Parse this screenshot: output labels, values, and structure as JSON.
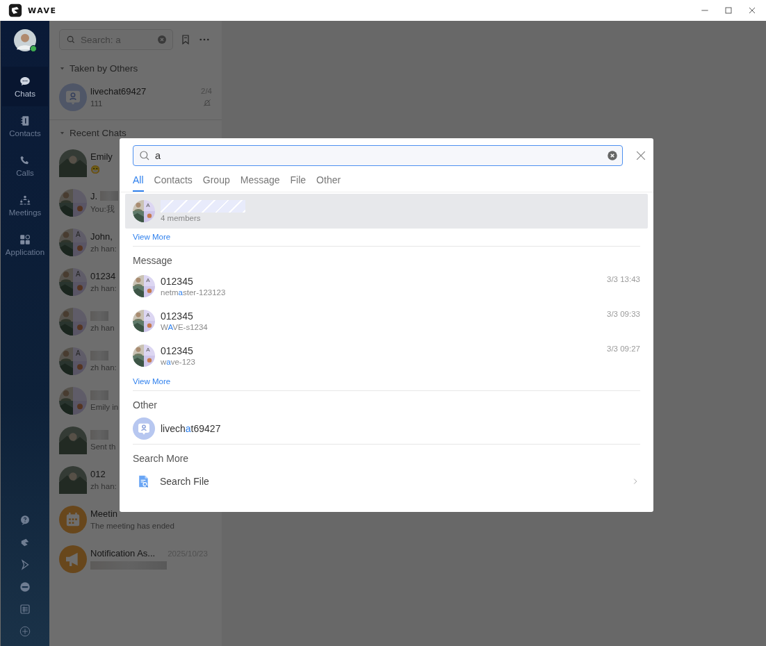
{
  "titlebar": {
    "app_name": "WAVE"
  },
  "nav": {
    "items": [
      {
        "label": "Chats",
        "selected": true
      },
      {
        "label": "Contacts",
        "selected": false
      },
      {
        "label": "Calls",
        "selected": false
      },
      {
        "label": "Meetings",
        "selected": false
      },
      {
        "label": "Application",
        "selected": false
      }
    ]
  },
  "chat_list": {
    "search": {
      "placeholder": "Search: a"
    },
    "sections": [
      {
        "title": "Taken by Others",
        "expanded": true,
        "items": [
          {
            "avatar": {
              "kind": "livechat"
            },
            "name": "livechat69427",
            "preview": "111",
            "count": "2/4",
            "muted": true
          }
        ]
      },
      {
        "title": "Recent Chats",
        "expanded": true,
        "items": [
          {
            "avatar": {
              "kind": "photo"
            },
            "name": "Emily",
            "preview": "😁",
            "redacted": false
          },
          {
            "avatar": {
              "kind": "group"
            },
            "name": "J.",
            "preview": "You:我",
            "redacted": true
          },
          {
            "avatar": {
              "kind": "group",
              "letter": "A"
            },
            "name": "John,",
            "preview": "zh han:",
            "redacted": false
          },
          {
            "avatar": {
              "kind": "group",
              "letter": "A"
            },
            "name": "01234",
            "preview": "zh han:",
            "redacted": false
          },
          {
            "avatar": {
              "kind": "group"
            },
            "preview": "zh han",
            "redacted": true
          },
          {
            "avatar": {
              "kind": "group",
              "letter": "A"
            },
            "preview": "zh han:",
            "redacted": true
          },
          {
            "avatar": {
              "kind": "group"
            },
            "preview": "Emily in",
            "redacted": true
          },
          {
            "avatar": {
              "kind": "photo"
            },
            "preview": "Sent th",
            "redacted": true
          },
          {
            "avatar": {
              "kind": "photo"
            },
            "name": "012",
            "preview": "zh han:",
            "redacted": false
          },
          {
            "avatar": {
              "kind": "meeting"
            },
            "name": "Meetin",
            "preview": "The meeting has ended",
            "redacted": false
          },
          {
            "avatar": {
              "kind": "notification"
            },
            "name": "Notification As...",
            "time": "2025/10/23",
            "redacted": true
          }
        ]
      }
    ]
  },
  "search_modal": {
    "query": "a",
    "tabs": [
      {
        "label": "All",
        "selected": true
      },
      {
        "label": "Contacts",
        "selected": false
      },
      {
        "label": "Group",
        "selected": false
      },
      {
        "label": "Message",
        "selected": false
      },
      {
        "label": "File",
        "selected": false
      },
      {
        "label": "Other",
        "selected": false
      }
    ],
    "groups": {
      "items": [
        {
          "avatar": {
            "kind": "group",
            "letter": "A"
          },
          "redacted": true,
          "members": "4 members",
          "highlighted": true
        }
      ],
      "view_more": "View More"
    },
    "message": {
      "title": "Message",
      "items": [
        {
          "avatar": {
            "kind": "group",
            "letter": "A"
          },
          "title": "012345",
          "snippet": [
            {
              "text": "netm",
              "match": false
            },
            {
              "text": "a",
              "match": true
            },
            {
              "text": "ster-123123",
              "match": false
            }
          ],
          "time": "3/3 13:43"
        },
        {
          "avatar": {
            "kind": "group",
            "letter": "A"
          },
          "title": "012345",
          "snippet": [
            {
              "text": "W",
              "match": false
            },
            {
              "text": "A",
              "match": true
            },
            {
              "text": "VE-s1234",
              "match": false
            }
          ],
          "time": "3/3 09:33"
        },
        {
          "avatar": {
            "kind": "group",
            "letter": "A"
          },
          "title": "012345",
          "snippet": [
            {
              "text": "w",
              "match": false
            },
            {
              "text": "a",
              "match": true
            },
            {
              "text": "ve-123",
              "match": false
            }
          ],
          "time": "3/3 09:27"
        }
      ],
      "view_more": "View More"
    },
    "other": {
      "title": "Other",
      "items": [
        {
          "avatar": {
            "kind": "livechat"
          },
          "name": [
            {
              "text": "livech",
              "match": false
            },
            {
              "text": "a",
              "match": true
            },
            {
              "text": "t69427",
              "match": false
            }
          ]
        }
      ]
    },
    "search_more": {
      "title": "Search More",
      "items": [
        {
          "label": "Search File"
        }
      ]
    }
  }
}
